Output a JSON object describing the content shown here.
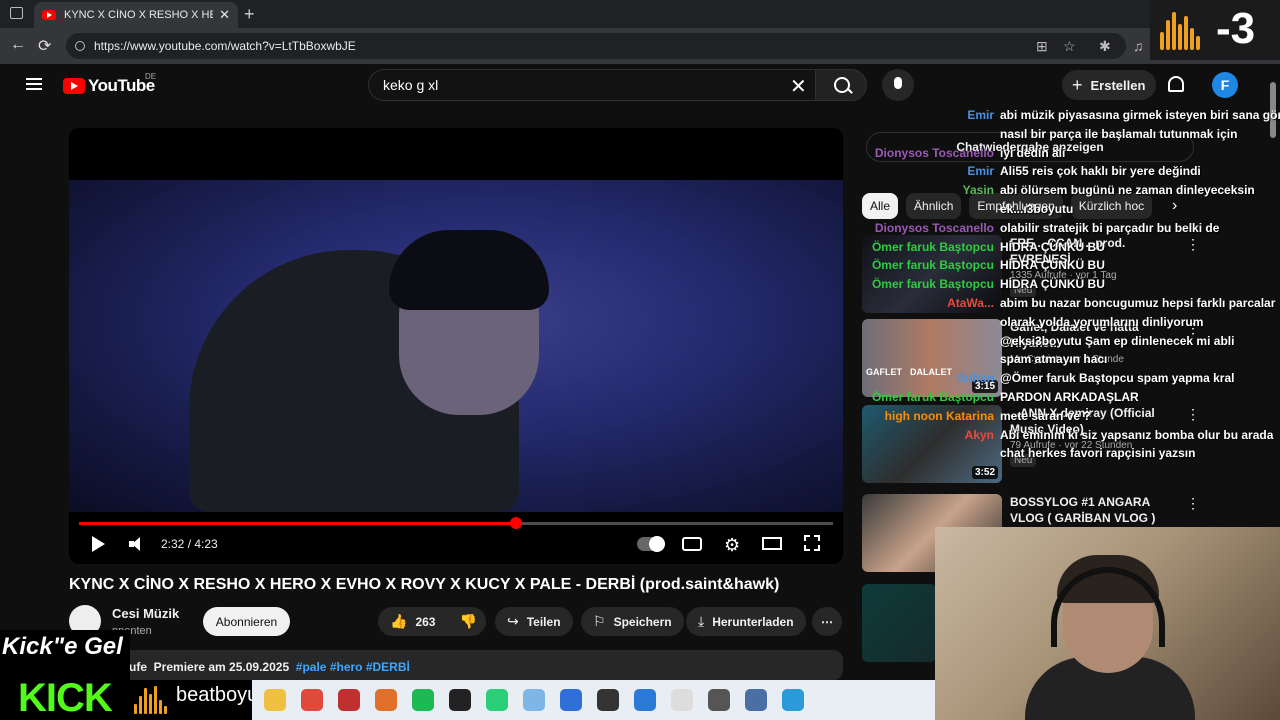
{
  "browser": {
    "tab_title": "KYNC X CİNO X RESHO X HERO X",
    "url": "https://www.youtube.com/watch?v=LtTbBoxwbJE"
  },
  "youtube": {
    "logo_text": "YouTube",
    "country": "DE",
    "search_value": "keko g xl",
    "create_label": "Erstellen",
    "avatar_letter": "F"
  },
  "video": {
    "time": "2:32 / 4:23",
    "progress_fraction": 0.58,
    "title": "KYNC X CİNO X RESHO X HERO X EVHO X ROVY X KUCY X PALE - DERBİ (prod.saint&hawk)",
    "channel": "Cesi Müzik",
    "subs": "nnenten",
    "subscribe": "Abonnieren",
    "likes": "263",
    "share": "Teilen",
    "save": "Speichern",
    "download": "Herunterladen",
    "desc_prefix": "ufe",
    "desc_premiere": "Premiere am 25.09.2025",
    "desc_tags": "#pale #hero #DERBİ"
  },
  "sidebar": {
    "chat_toggle": "Chatwiedergabe anzeigen",
    "chips": [
      "Alle",
      "Ähnlich",
      "Empfehlungen",
      "Kürzlich hoc"
    ],
    "recs": [
      {
        "title": "FRE... CCAN... prod. EVRENESİ",
        "meta": "1335 Aufrufe · vor 1 Tag",
        "badge": "Neu",
        "duration": ""
      },
      {
        "title": "Gaflet, Dalalet ve hatta Hıyanet.",
        "meta": "Mr. Cypriot · vor 1 Stunde",
        "badge": "",
        "duration": "3:15",
        "t1": "GAFLET",
        "t2": "DALALET"
      },
      {
        "title": "...ANN X demiray (Official Music Video)",
        "meta": "79 Aufrufe · vor 22 Stunden",
        "badge": "Neu",
        "duration": "3:52"
      },
      {
        "title": "BOSSYLOG #1 ANGARA VLOG ( GARİBAN VLOG )",
        "meta": "",
        "badge": "",
        "duration": ""
      }
    ]
  },
  "chat": [
    {
      "user": "Emir",
      "color": "#4a90e2",
      "text": "abi müzik piyasasına girmek isteyen biri sana göre"
    },
    {
      "user": "",
      "color": "#ffffff",
      "text": "nasıl bir parça ile başlamalı tutunmak için"
    },
    {
      "user": "Dionysos Toscanello",
      "color": "#9b59b6",
      "text": "iyi dedin ali"
    },
    {
      "user": "Emir",
      "color": "#4a90e2",
      "text": "Ali55 reis çok haklı bir yere değindi"
    },
    {
      "user": "Yasin",
      "color": "#5cb85c",
      "text": "abi ölürsem bugünü ne zaman dinleyeceksin"
    },
    {
      "user": "",
      "color": "#ffffff",
      "text": "ek...ı3boyutu"
    },
    {
      "user": "Dionysos Toscanello",
      "color": "#9b59b6",
      "text": "olabilir stratejik bi parçadır bu belki de"
    },
    {
      "user": "Ömer faruk Baştopcu",
      "color": "#2ecc40",
      "text": "HİDRA ÇÜNKÜ BU"
    },
    {
      "user": "Ömer faruk Baştopcu",
      "color": "#2ecc40",
      "text": "HİDRA ÇÜNKÜ BU"
    },
    {
      "user": "Ömer faruk Baştopcu",
      "color": "#2ecc40",
      "text": "HİDRA ÇÜNKÜ BU"
    },
    {
      "user": "AtaWa...",
      "color": "#e74c3c",
      "text": "abim bu nazar boncugumuz hepsi farklı parcalar"
    },
    {
      "user": "",
      "color": "#ffffff",
      "text": "olarak yolda yorumlarını dinliyorum"
    },
    {
      "user": "",
      "color": "#ffffff",
      "text": "@eksi3boyutu Şam ep dinlenecek mi abli"
    },
    {
      "user": "",
      "color": "#ffffff",
      "text": "spam atmayın hacı"
    },
    {
      "user": "Sultan",
      "color": "#4a90e2",
      "text": "@Ömer faruk Baştopcu spam yapma kral"
    },
    {
      "user": "Ömer faruk Baştopcu",
      "color": "#2ecc40",
      "text": "PARDON ARKADAŞLAR"
    },
    {
      "user": "high noon Katarina",
      "color": "#ff8c00",
      "text": "mete saran ve ?"
    },
    {
      "user": "Akyn",
      "color": "#e74c3c",
      "text": "Abi eminim ki siz yapsanız bomba olur bu arada"
    },
    {
      "user": "",
      "color": "#ffffff",
      "text": "chat herkes favori rapçisini yazsın"
    }
  ],
  "overlays": {
    "counter": "-3",
    "kick_top": "Kick\"e Gel",
    "kick_word": "KICK",
    "beatboyutu": "beatboyutu"
  },
  "taskbar_apps": [
    "folder",
    "chrome",
    "git",
    "firefox",
    "spotify",
    "cmd",
    "pycharm",
    "note",
    "shield",
    "obs",
    "vscode",
    "file",
    "clock",
    "calc",
    "edge"
  ]
}
